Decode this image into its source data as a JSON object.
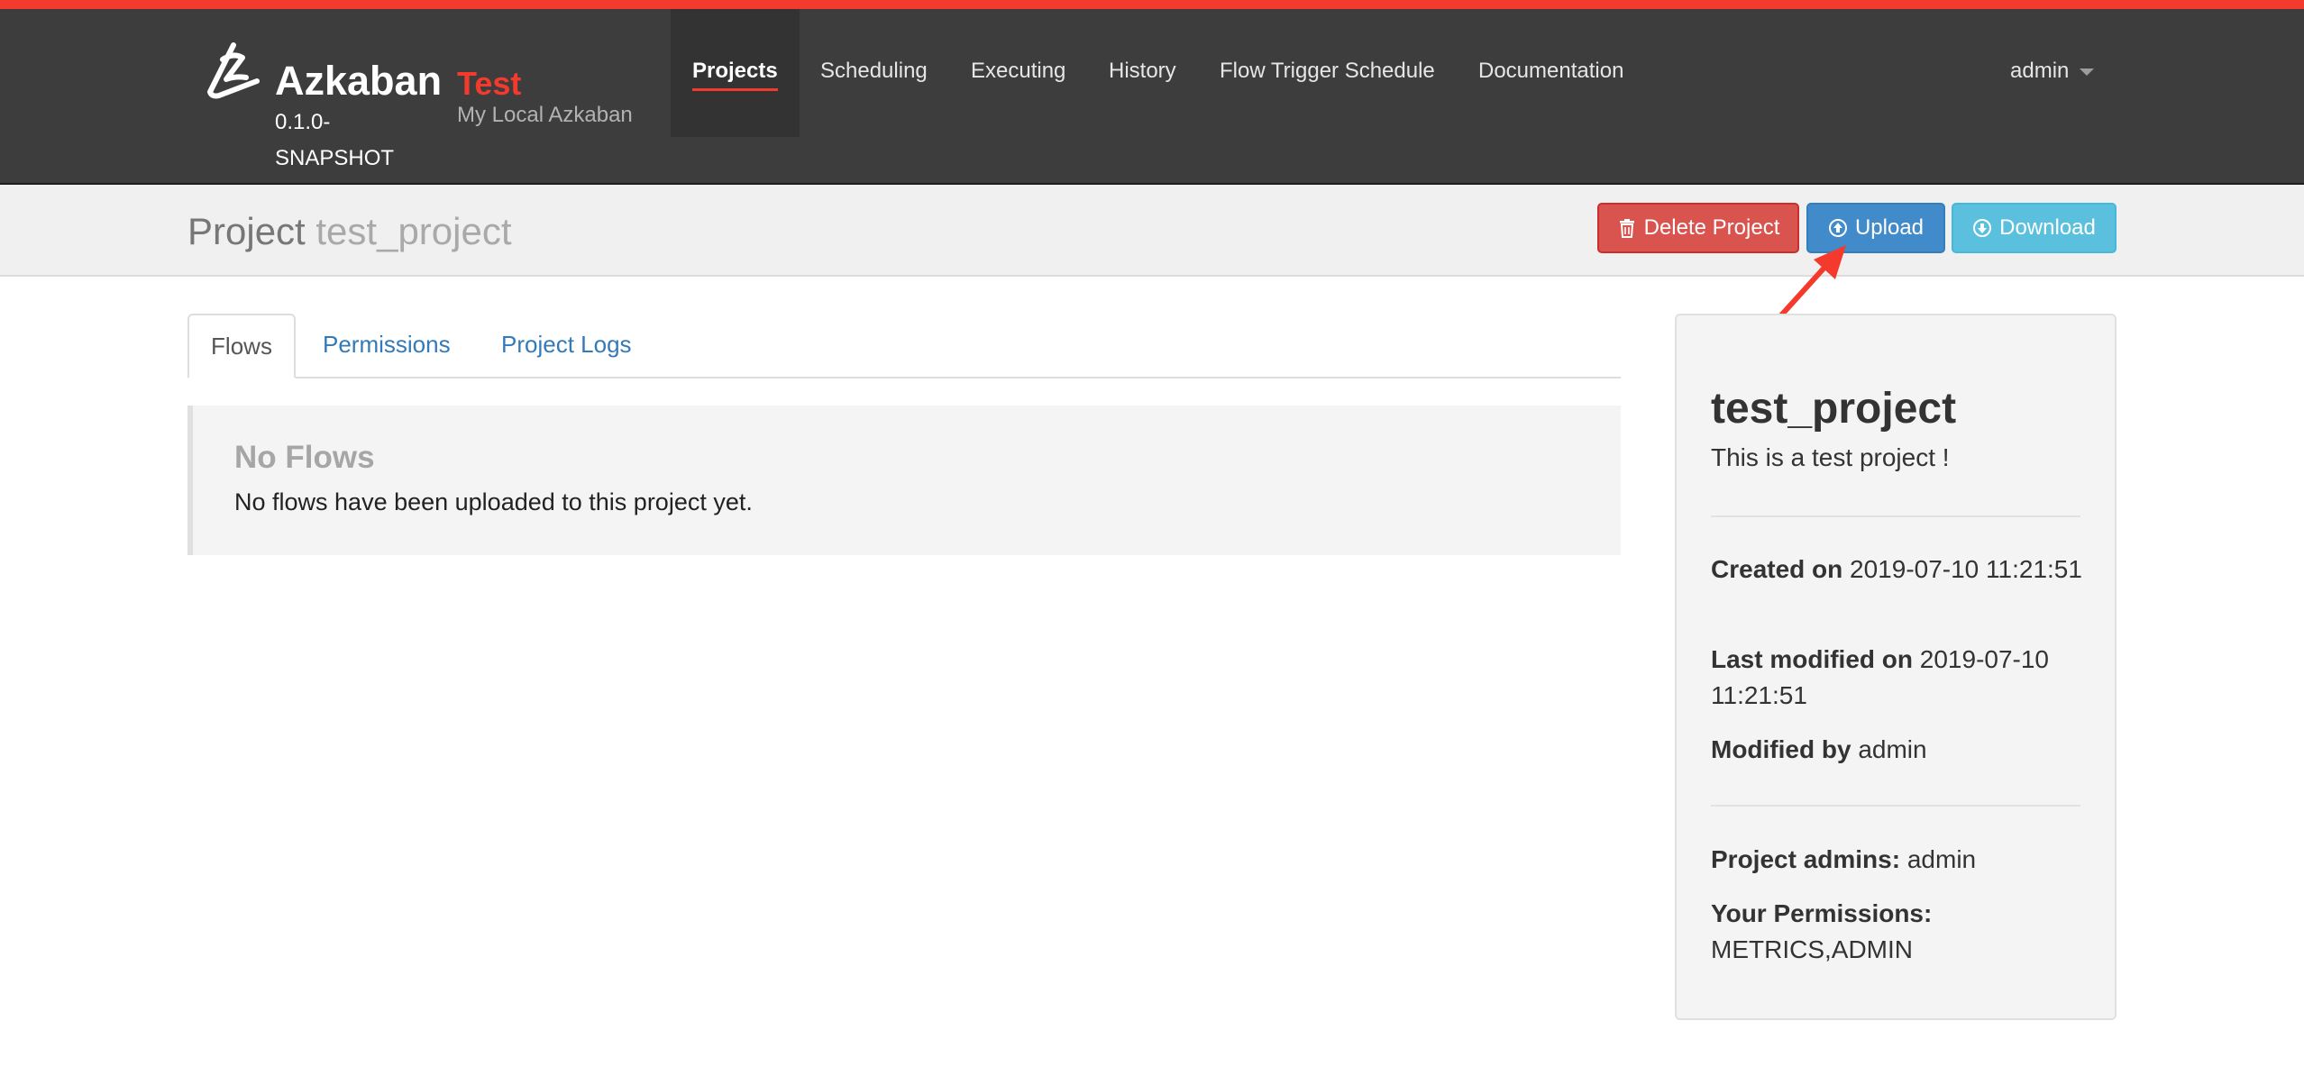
{
  "brand": {
    "name": "Azkaban",
    "version": "0.1.0-SNAPSHOT",
    "env_name": "Test",
    "env_description": "My Local Azkaban"
  },
  "nav": {
    "items": [
      {
        "label": "Projects",
        "active": true
      },
      {
        "label": "Scheduling"
      },
      {
        "label": "Executing"
      },
      {
        "label": "History"
      },
      {
        "label": "Flow Trigger Schedule"
      },
      {
        "label": "Documentation"
      }
    ],
    "user": "admin"
  },
  "project_header": {
    "label": "Project",
    "name": "test_project",
    "buttons": {
      "delete": "Delete Project",
      "upload": "Upload",
      "download": "Download"
    }
  },
  "tabs": [
    "Flows",
    "Permissions",
    "Project Logs"
  ],
  "flows": {
    "empty_title": "No Flows",
    "empty_text": "No flows have been uploaded to this project yet."
  },
  "panel": {
    "title": "test_project",
    "description": "This is a test project !",
    "created_label": "Created on",
    "created_value": "2019-07-10 11:21:51",
    "modified_label": "Last modified on",
    "modified_value": "2019-07-10 11:21:51",
    "modified_by_label": "Modified by",
    "modified_by_value": "admin",
    "admins_label": "Project admins:",
    "admins_value": "admin",
    "permissions_label": "Your Permissions:",
    "permissions_value": "METRICS,ADMIN"
  },
  "colors": {
    "accent_red": "#f43a2c",
    "navbar": "#3d3d3d",
    "danger": "#d9534f",
    "primary": "#428bca",
    "info": "#5bc0de"
  }
}
